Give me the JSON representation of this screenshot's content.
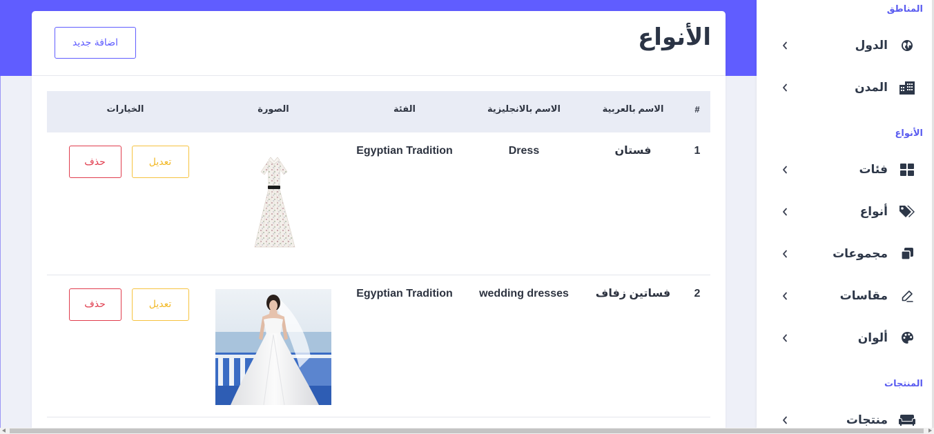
{
  "sidebar": {
    "sections": [
      {
        "title": "المناطق",
        "items": [
          {
            "label": "الدول",
            "icon": "globe-icon"
          },
          {
            "label": "المدن",
            "icon": "city-icon"
          }
        ]
      },
      {
        "title": "الأنواع",
        "items": [
          {
            "label": "فئات",
            "icon": "th-large-icon"
          },
          {
            "label": "أنواع",
            "icon": "tags-icon"
          },
          {
            "label": "مجموعات",
            "icon": "clone-icon"
          },
          {
            "label": "مقاسات",
            "icon": "edit-icon"
          },
          {
            "label": "ألوان",
            "icon": "palette-icon"
          }
        ]
      },
      {
        "title": "المنتجات",
        "items": [
          {
            "label": "منتجات",
            "icon": "couch-icon"
          }
        ]
      }
    ]
  },
  "page": {
    "title": "الأنواع",
    "add_button": "اضافة جديد"
  },
  "table": {
    "headers": [
      "#",
      "الاسم بالعربية",
      "الاسم بالانجليزية",
      "الفئة",
      "الصورة",
      "الخيارات"
    ],
    "actions": {
      "edit": "تعديل",
      "delete": "حذف"
    },
    "rows": [
      {
        "id": "1",
        "name_ar": "فستان",
        "name_en": "Dress",
        "category": "Egyptian Tradition"
      },
      {
        "id": "2",
        "name_ar": "فساتين زفاف",
        "name_en": "wedding dresses",
        "category": "Egyptian Tradition"
      }
    ]
  },
  "colors": {
    "accent": "#605dff",
    "sidebar_section": "#5a5cf0",
    "edit": "#f6c23e",
    "delete": "#e03b4c",
    "text": "#2d3748",
    "page_bg": "#eef0f8",
    "table_header_bg": "#e9ecf5"
  }
}
